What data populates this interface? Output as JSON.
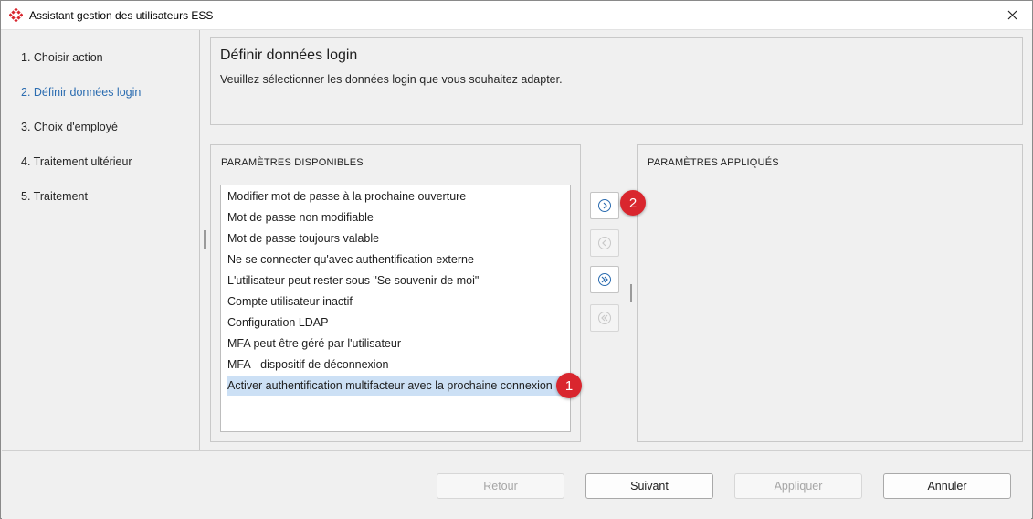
{
  "window": {
    "title": "Assistant gestion des utilisateurs ESS",
    "accent_color": "#d9262e",
    "close_icon": "close-icon"
  },
  "steps": [
    {
      "label": "1. Choisir action",
      "active": false
    },
    {
      "label": "2. Définir données login",
      "active": true
    },
    {
      "label": "3. Choix d'employé",
      "active": false
    },
    {
      "label": "4. Traitement ultérieur",
      "active": false
    },
    {
      "label": "5. Traitement",
      "active": false
    }
  ],
  "header": {
    "title": "Définir données login",
    "description": "Veuillez sélectionner les données login que vous souhaitez adapter."
  },
  "available": {
    "title": "PARAMÈTRES DISPONIBLES",
    "items": [
      "Modifier mot de passe à la prochaine ouverture",
      "Mot de passe non modifiable",
      "Mot de passe toujours valable",
      "Ne se connecter qu'avec authentification externe",
      "L'utilisateur peut rester sous \"Se souvenir de moi\"",
      "Compte utilisateur inactif",
      "Configuration LDAP",
      "MFA peut être géré par l'utilisateur",
      "MFA - dispositif de déconnexion",
      "Activer authentification multifacteur avec la prochaine connexion"
    ],
    "selected_index": 9
  },
  "applied": {
    "title": "PARAMÈTRES APPLIQUÉS",
    "items": []
  },
  "transfer_buttons": [
    {
      "icon": "chevron-right-icon",
      "enabled": true
    },
    {
      "icon": "chevron-left-icon",
      "enabled": false
    },
    {
      "icon": "double-chevron-right-icon",
      "enabled": true
    },
    {
      "icon": "double-chevron-left-icon",
      "enabled": false
    }
  ],
  "badges": [
    {
      "label": "1",
      "color": "#d9262e"
    },
    {
      "label": "2",
      "color": "#d9262e"
    }
  ],
  "footer": {
    "back": "Retour",
    "next": "Suivant",
    "apply": "Appliquer",
    "cancel": "Annuler"
  }
}
